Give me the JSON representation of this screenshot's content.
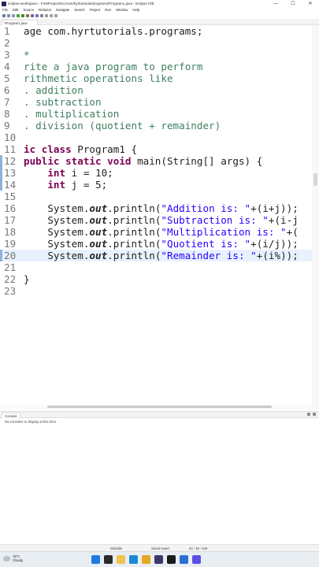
{
  "window": {
    "title": "eclipse-workspace - FirstProject/src/com/hyrtutorials/programs/Program1.java - Eclipse IDE",
    "minimize": "—",
    "maximize": "☐",
    "close": "✕"
  },
  "menu": [
    "File",
    "Edit",
    "Source",
    "Refactor",
    "Navigate",
    "Search",
    "Project",
    "Run",
    "Window",
    "Help"
  ],
  "editor_tab": "*Program1.java",
  "code_lines": [
    {
      "n": "1",
      "parts": [
        {
          "t": "age com.hyrtutorials.programs;",
          "c": ""
        }
      ]
    },
    {
      "n": "2",
      "parts": []
    },
    {
      "n": "3",
      "parts": [
        {
          "t": "*",
          "c": "cmt"
        }
      ]
    },
    {
      "n": "4",
      "parts": [
        {
          "t": "rite a java program to perform",
          "c": "cmt"
        }
      ]
    },
    {
      "n": "5",
      "parts": [
        {
          "t": "rithmetic operations like",
          "c": "cmt"
        }
      ]
    },
    {
      "n": "6",
      "parts": [
        {
          "t": ". addition",
          "c": "cmt"
        }
      ]
    },
    {
      "n": "7",
      "parts": [
        {
          "t": ". subtraction",
          "c": "cmt"
        }
      ]
    },
    {
      "n": "8",
      "parts": [
        {
          "t": ". multiplication",
          "c": "cmt"
        }
      ]
    },
    {
      "n": "9",
      "parts": [
        {
          "t": ". division (quotient + remainder)",
          "c": "cmt"
        }
      ]
    },
    {
      "n": "10",
      "parts": []
    },
    {
      "n": "11",
      "parts": [
        {
          "t": "ic class ",
          "c": "kw"
        },
        {
          "t": "Program1 {",
          "c": ""
        }
      ]
    },
    {
      "n": "12",
      "parts": [
        {
          "t": "public static void ",
          "c": "kw"
        },
        {
          "t": "main(String[] args) {",
          "c": ""
        }
      ]
    },
    {
      "n": "13",
      "parts": [
        {
          "t": "    int ",
          "c": "kw"
        },
        {
          "t": "i = 10;",
          "c": ""
        }
      ]
    },
    {
      "n": "14",
      "parts": [
        {
          "t": "    int ",
          "c": "kw"
        },
        {
          "t": "j = 5;",
          "c": ""
        }
      ]
    },
    {
      "n": "15",
      "parts": []
    },
    {
      "n": "16",
      "parts": [
        {
          "t": "    System.",
          "c": ""
        },
        {
          "t": "out",
          "c": "fld"
        },
        {
          "t": ".println(",
          "c": ""
        },
        {
          "t": "\"Addition is: \"",
          "c": "str"
        },
        {
          "t": "+(i+j));",
          "c": ""
        }
      ]
    },
    {
      "n": "17",
      "parts": [
        {
          "t": "    System.",
          "c": ""
        },
        {
          "t": "out",
          "c": "fld"
        },
        {
          "t": ".println(",
          "c": ""
        },
        {
          "t": "\"Subtraction is: \"",
          "c": "str"
        },
        {
          "t": "+(i-j",
          "c": ""
        }
      ]
    },
    {
      "n": "18",
      "parts": [
        {
          "t": "    System.",
          "c": ""
        },
        {
          "t": "out",
          "c": "fld"
        },
        {
          "t": ".println(",
          "c": ""
        },
        {
          "t": "\"Multiplication is: \"",
          "c": "str"
        },
        {
          "t": "+(",
          "c": ""
        }
      ]
    },
    {
      "n": "19",
      "parts": [
        {
          "t": "    System.",
          "c": ""
        },
        {
          "t": "out",
          "c": "fld"
        },
        {
          "t": ".println(",
          "c": ""
        },
        {
          "t": "\"Quotient is: \"",
          "c": "str"
        },
        {
          "t": "+(i/j));",
          "c": ""
        }
      ]
    },
    {
      "n": "20",
      "parts": [
        {
          "t": "    System.",
          "c": ""
        },
        {
          "t": "out",
          "c": "fld"
        },
        {
          "t": ".println(",
          "c": ""
        },
        {
          "t": "\"Remainder is: \"",
          "c": "str"
        },
        {
          "t": "+(i%));",
          "c": ""
        }
      ]
    },
    {
      "n": "21",
      "parts": []
    },
    {
      "n": "22",
      "parts": [
        {
          "t": "}",
          "c": ""
        }
      ]
    },
    {
      "n": "23",
      "parts": []
    }
  ],
  "current_line": "20",
  "changed_lines": [
    "12",
    "13",
    "14",
    "20"
  ],
  "console": {
    "tab": "Console",
    "message": "No consoles to display at this time."
  },
  "status": {
    "mode": "Writable",
    "insert": "Smart Insert",
    "position": "20 : 48 : 546"
  },
  "taskbar": {
    "temperature": "19°C",
    "condition": "Cloudy"
  },
  "colors": {
    "keyword": "#7f0055",
    "string": "#2a00ff",
    "comment": "#3f7f5f",
    "current_line": "#e8f2fe"
  }
}
